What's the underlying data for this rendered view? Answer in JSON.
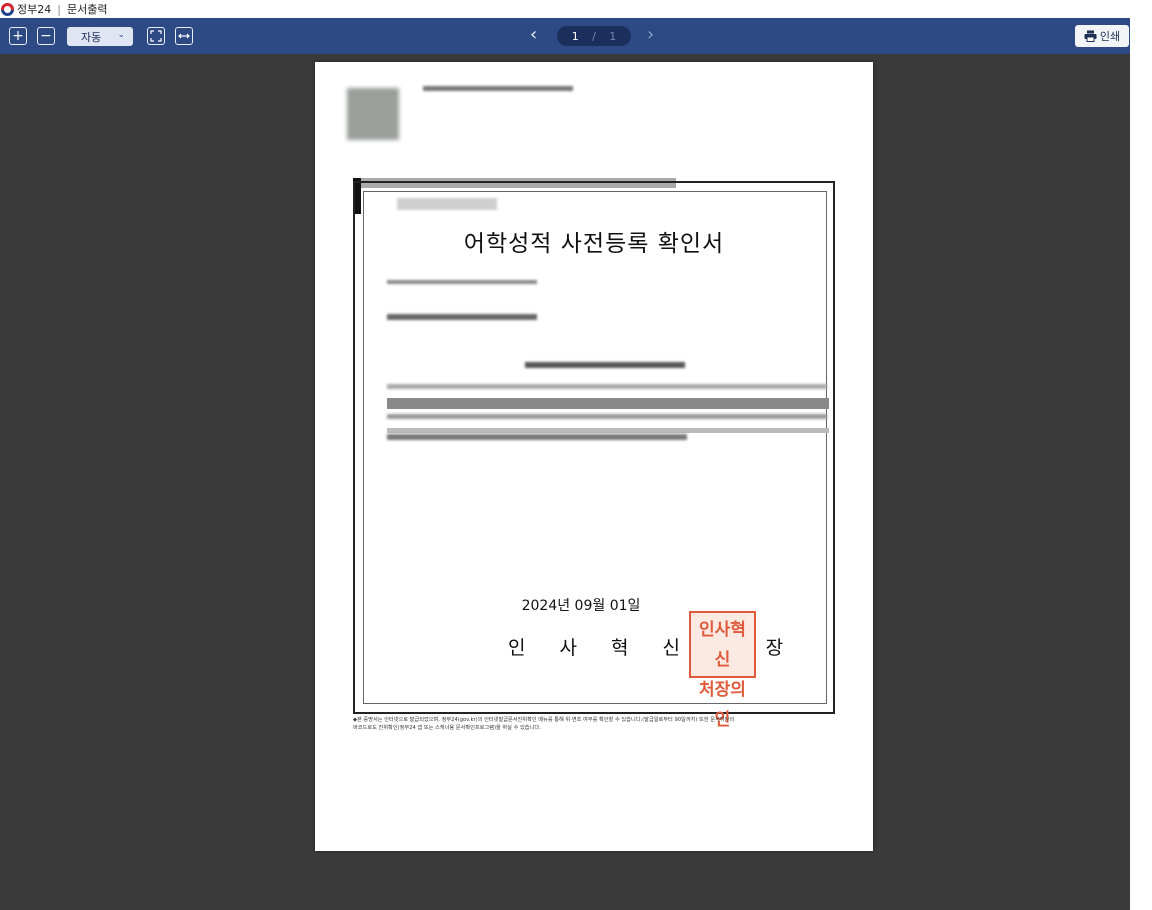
{
  "titlebar": {
    "app": "정부24",
    "separator": "|",
    "window": "문서출력"
  },
  "toolbar": {
    "zoom_in_icon": "plus-icon",
    "zoom_out_icon": "minus-icon",
    "zoom_value": "자동",
    "fit_page_icon": "fit-page-icon",
    "fit_width_icon": "fit-width-icon",
    "prev_icon": "chevron-left-icon",
    "next_icon": "chevron-right-icon",
    "current_page": "1",
    "page_separator": "/",
    "total_pages": "1",
    "print_label": "인쇄"
  },
  "document": {
    "title": "어학성적 사전등록 확인서",
    "date": "2024년 09월 01일",
    "issuer": "인 사 혁 신 처 장",
    "seal": [
      "인사혁신",
      "처장의인"
    ],
    "footnote_line1": "◆본 증명서는 인터넷으로 발급되었으며, 정부24(gov.kr)의 인터넷발급문서진위확인 메뉴를 통해 위·변조 여부를 확인할 수 있습니다.(발급일로부터 90일까지) 또한 문서하단의",
    "footnote_line2": "바코드로도 진위확인(정부24 앱 또는 스캐너용 문서확인프로그램)을 하실 수 있습니다."
  },
  "colors": {
    "toolbar": "#2d4a84",
    "viewer_bg": "#3a3a3a",
    "seal": "#e05a3c"
  }
}
